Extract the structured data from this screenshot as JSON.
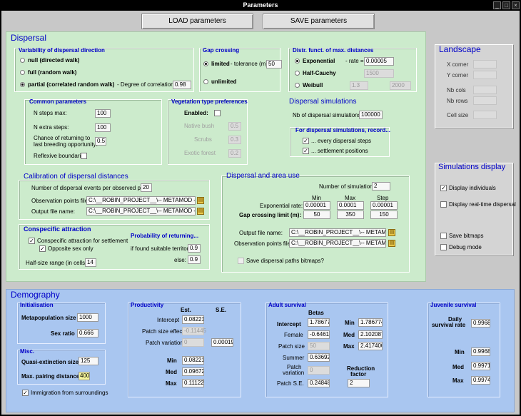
{
  "window": {
    "title": "Parameters"
  },
  "toolbar": {
    "load": "LOAD parameters",
    "save": "SAVE parameters"
  },
  "dispersal": {
    "title": "Dispersal",
    "variability": {
      "title": "Variability of dispersal direction",
      "null": "null (directed walk)",
      "full": "full (random walk)",
      "partial": "partial (correlated random walk)",
      "corr_label": "Degree of correlation =",
      "corr": "0.98"
    },
    "gap": {
      "title": "Gap crossing",
      "limited": "limited",
      "tol_label": "tolerance (m):",
      "tol": "50",
      "unlimited": "unlimited"
    },
    "distr": {
      "title": "Distr. funct. of max. distances",
      "exp": "Exponential",
      "rate_label": "rate =",
      "rate": "0.00005",
      "half": "Half-Cauchy",
      "half_val": "1500",
      "weibull": "Weibull",
      "w1": "1.3",
      "w2": "2000"
    },
    "common": {
      "title": "Common parameters",
      "nmax_l": "N steps max:",
      "nmax": "100",
      "nextra_l": "N extra steps:",
      "nextra": "100",
      "chance_l1": "Chance of returning to",
      "chance_l2": "last breeding opportunity:",
      "chance": "0.5",
      "reflex": "Reflexive boundaries"
    },
    "veg": {
      "title": "Vegetation type preferences",
      "enabled": "Enabled:",
      "native": "Native bush",
      "native_v": "0.5",
      "scrubs": "Scrubs",
      "scrubs_v": "0.3",
      "exotic": "Exotic forest",
      "exotic_v": "0.2"
    },
    "sims": {
      "title": "Dispersal simulations",
      "nb_l": "Nb of dispersal simulations =",
      "nb": "100000",
      "rec": "For dispersal simulations, record...",
      "every": "... every dispersal steps",
      "settle": "... settlement positions"
    },
    "calib": {
      "title": "Calibration of dispersal distances",
      "num_l": "Number of dispersal events per observed point:",
      "num": "20",
      "obs_l": "Observation points file:",
      "obs": "C:\\__ROBIN_PROJECT__\\-- METAMOD --\\--F",
      "out_l": "Output file name:",
      "out": "C:\\__ROBIN_PROJECT__\\-- METAMOD --\\--F"
    },
    "cons": {
      "title": "Conspecific attraction",
      "c1": "Conspecific attraction for settlement",
      "c2": "Opposite sex only",
      "half_l": "Half-size range (in cells) =",
      "half": "14",
      "prob": "Probability of returning...",
      "found_l": "if found suitable territory:",
      "found": "0.9",
      "else_l": "else:",
      "else": "0.9"
    },
    "area": {
      "title": "Dispersal and area use",
      "nsim_l": "Number of simulations:",
      "nsim": "2",
      "min": "Min",
      "max": "Max",
      "step": "Step",
      "exp_l": "Exponential rate:",
      "exp_min": "0.00001",
      "exp_max": "0.0001",
      "exp_step": "0.00001",
      "gap_l": "Gap crossing limit (m):",
      "gap_min": "50",
      "gap_max": "350",
      "gap_step": "150",
      "out_l": "Output file name:",
      "out": "C:\\__ROBIN_PROJECT__\\-- METAMOD --",
      "obs_l": "Observation points file:",
      "obs": "C:\\__ROBIN_PROJECT__\\-- METAMOD --",
      "save": "Save dispersal paths bitmaps?"
    }
  },
  "landscape": {
    "title": "Landscape",
    "x": "X corner",
    "y": "Y corner",
    "cols": "Nb cols",
    "rows": "Nb rows",
    "cell": "Cell size"
  },
  "simdisp": {
    "title": "Simulations display",
    "ind": "Display individuals",
    "rt": "Display real-time dispersal",
    "bmp": "Save bitmaps",
    "debug": "Debug mode"
  },
  "demo": {
    "title": "Demography",
    "init": {
      "title": "Initialisation",
      "meta_l": "Metapopulation size",
      "meta": "1000",
      "sex_l": "Sex ratio",
      "sex": "0.666"
    },
    "misc": {
      "title": "Misc.",
      "qe_l": "Quasi-extinction size",
      "qe": "125",
      "mp_l": "Max. pairing distance",
      "mp": "400"
    },
    "immig": "Immigration from surroundings",
    "prod": {
      "title": "Productivity",
      "est": "Est.",
      "se": "S.E.",
      "int_l": "Intercept",
      "int": "0.08221",
      "pse_l": "Patch size effect",
      "pse": "-0.11445",
      "pv_l": "Patch variation",
      "pv": "0",
      "pv_se": "0.00019",
      "min_l": "Min",
      "min": "0.08221",
      "med_l": "Med",
      "med": "0.09672",
      "max_l": "Max",
      "max": "0.11122"
    },
    "adult": {
      "title": "Adult survival",
      "betas": "Betas",
      "int_l": "Intercept",
      "int": "1.78677",
      "fem_l": "Female",
      "fem": "-0.64614",
      "ps_l": "Patch size",
      "ps": "50",
      "sum_l": "Summer",
      "sum": "0.63692",
      "pv_l1": "Patch",
      "pv_l2": "variation",
      "pv": "0",
      "pse_l": "Patch S.E.",
      "pse": "0.24848",
      "min_l": "Min",
      "min": "1.786774",
      "med_l": "Med",
      "med": "2.102087",
      "max_l": "Max",
      "max": "2.417400",
      "red1": "Reduction",
      "red2": "factor",
      "red": "2"
    },
    "juv": {
      "title": "Juvenile survival",
      "daily1": "Daily",
      "daily2": "survival rate",
      "daily": "0.9968",
      "min_l": "Min",
      "min": "0.9968",
      "med_l": "Med",
      "med": "0.9971",
      "max_l": "Max",
      "max": "0.9974"
    }
  }
}
